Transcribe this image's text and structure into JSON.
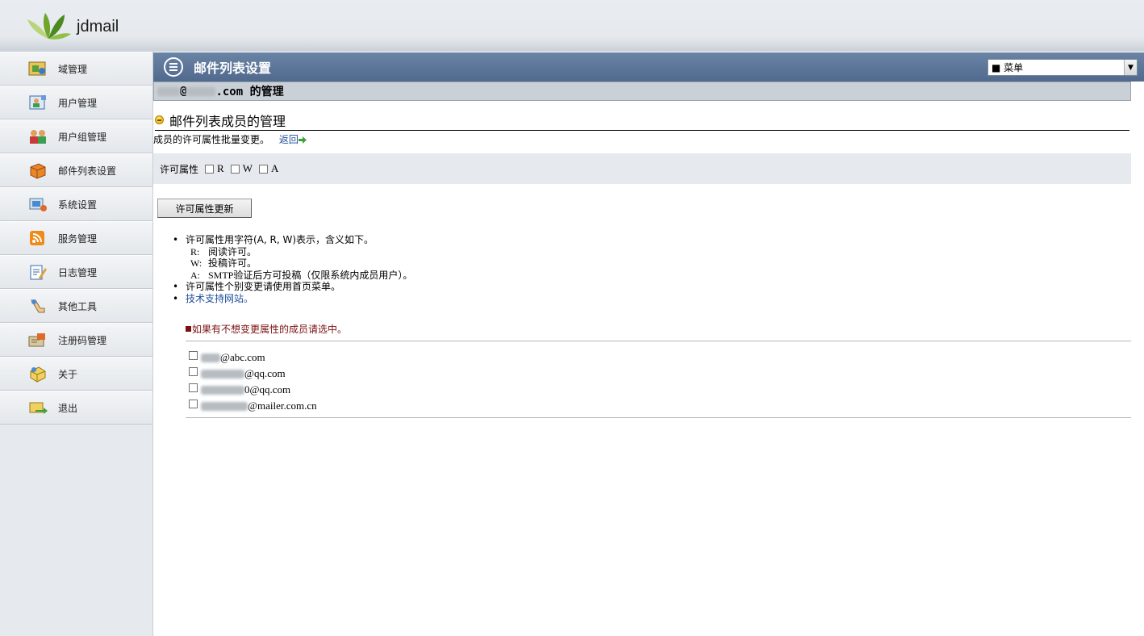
{
  "app": {
    "brand": "jdmail"
  },
  "sidebar": {
    "items": [
      {
        "label": "域管理",
        "icon": "domain-icon"
      },
      {
        "label": "用户管理",
        "icon": "user-icon"
      },
      {
        "label": "用户组管理",
        "icon": "user-group-icon"
      },
      {
        "label": "邮件列表设置",
        "icon": "mailing-list-icon"
      },
      {
        "label": "系统设置",
        "icon": "system-settings-icon"
      },
      {
        "label": "服务管理",
        "icon": "service-icon"
      },
      {
        "label": "日志管理",
        "icon": "log-icon"
      },
      {
        "label": "其他工具",
        "icon": "tools-icon"
      },
      {
        "label": "注册码管理",
        "icon": "license-icon"
      },
      {
        "label": "关于",
        "icon": "about-icon"
      },
      {
        "label": "退出",
        "icon": "logout-icon"
      }
    ]
  },
  "header": {
    "title": "邮件列表设置",
    "menu_select": "■ 菜单"
  },
  "subhead": {
    "address_middle": "@",
    "address_suffix": ".com 的管理"
  },
  "section": {
    "title": "邮件列表成员的管理",
    "description": "成员的许可属性批量变更。",
    "back_link": "返回"
  },
  "permission": {
    "label": "许可属性",
    "options": [
      "R",
      "W",
      "A"
    ]
  },
  "update_button": "许可属性更新",
  "notes": {
    "line1": "许可属性用字符(A, R, W)表示，含义如下。",
    "r_key": "R:",
    "r_text": "阅读许可。",
    "w_key": "W:",
    "w_text": "投稿许可。",
    "a_key": "A:",
    "a_text": "SMTP验证后方可投稿（仅限系统内成员用户）。",
    "line2": "许可属性个别变更请使用首页菜单。",
    "support_link": "技术支持网站。"
  },
  "hint": "如果有不想变更属性的成员请选中。",
  "members": [
    {
      "visible_part": "@abc.com"
    },
    {
      "visible_part": "@qq.com"
    },
    {
      "visible_part": "0@qq.com"
    },
    {
      "visible_part": "@mailer.com.cn"
    }
  ],
  "colors": {
    "titlebar": "#5b7598",
    "hint": "#7a1010",
    "link": "#1f4e9a"
  }
}
